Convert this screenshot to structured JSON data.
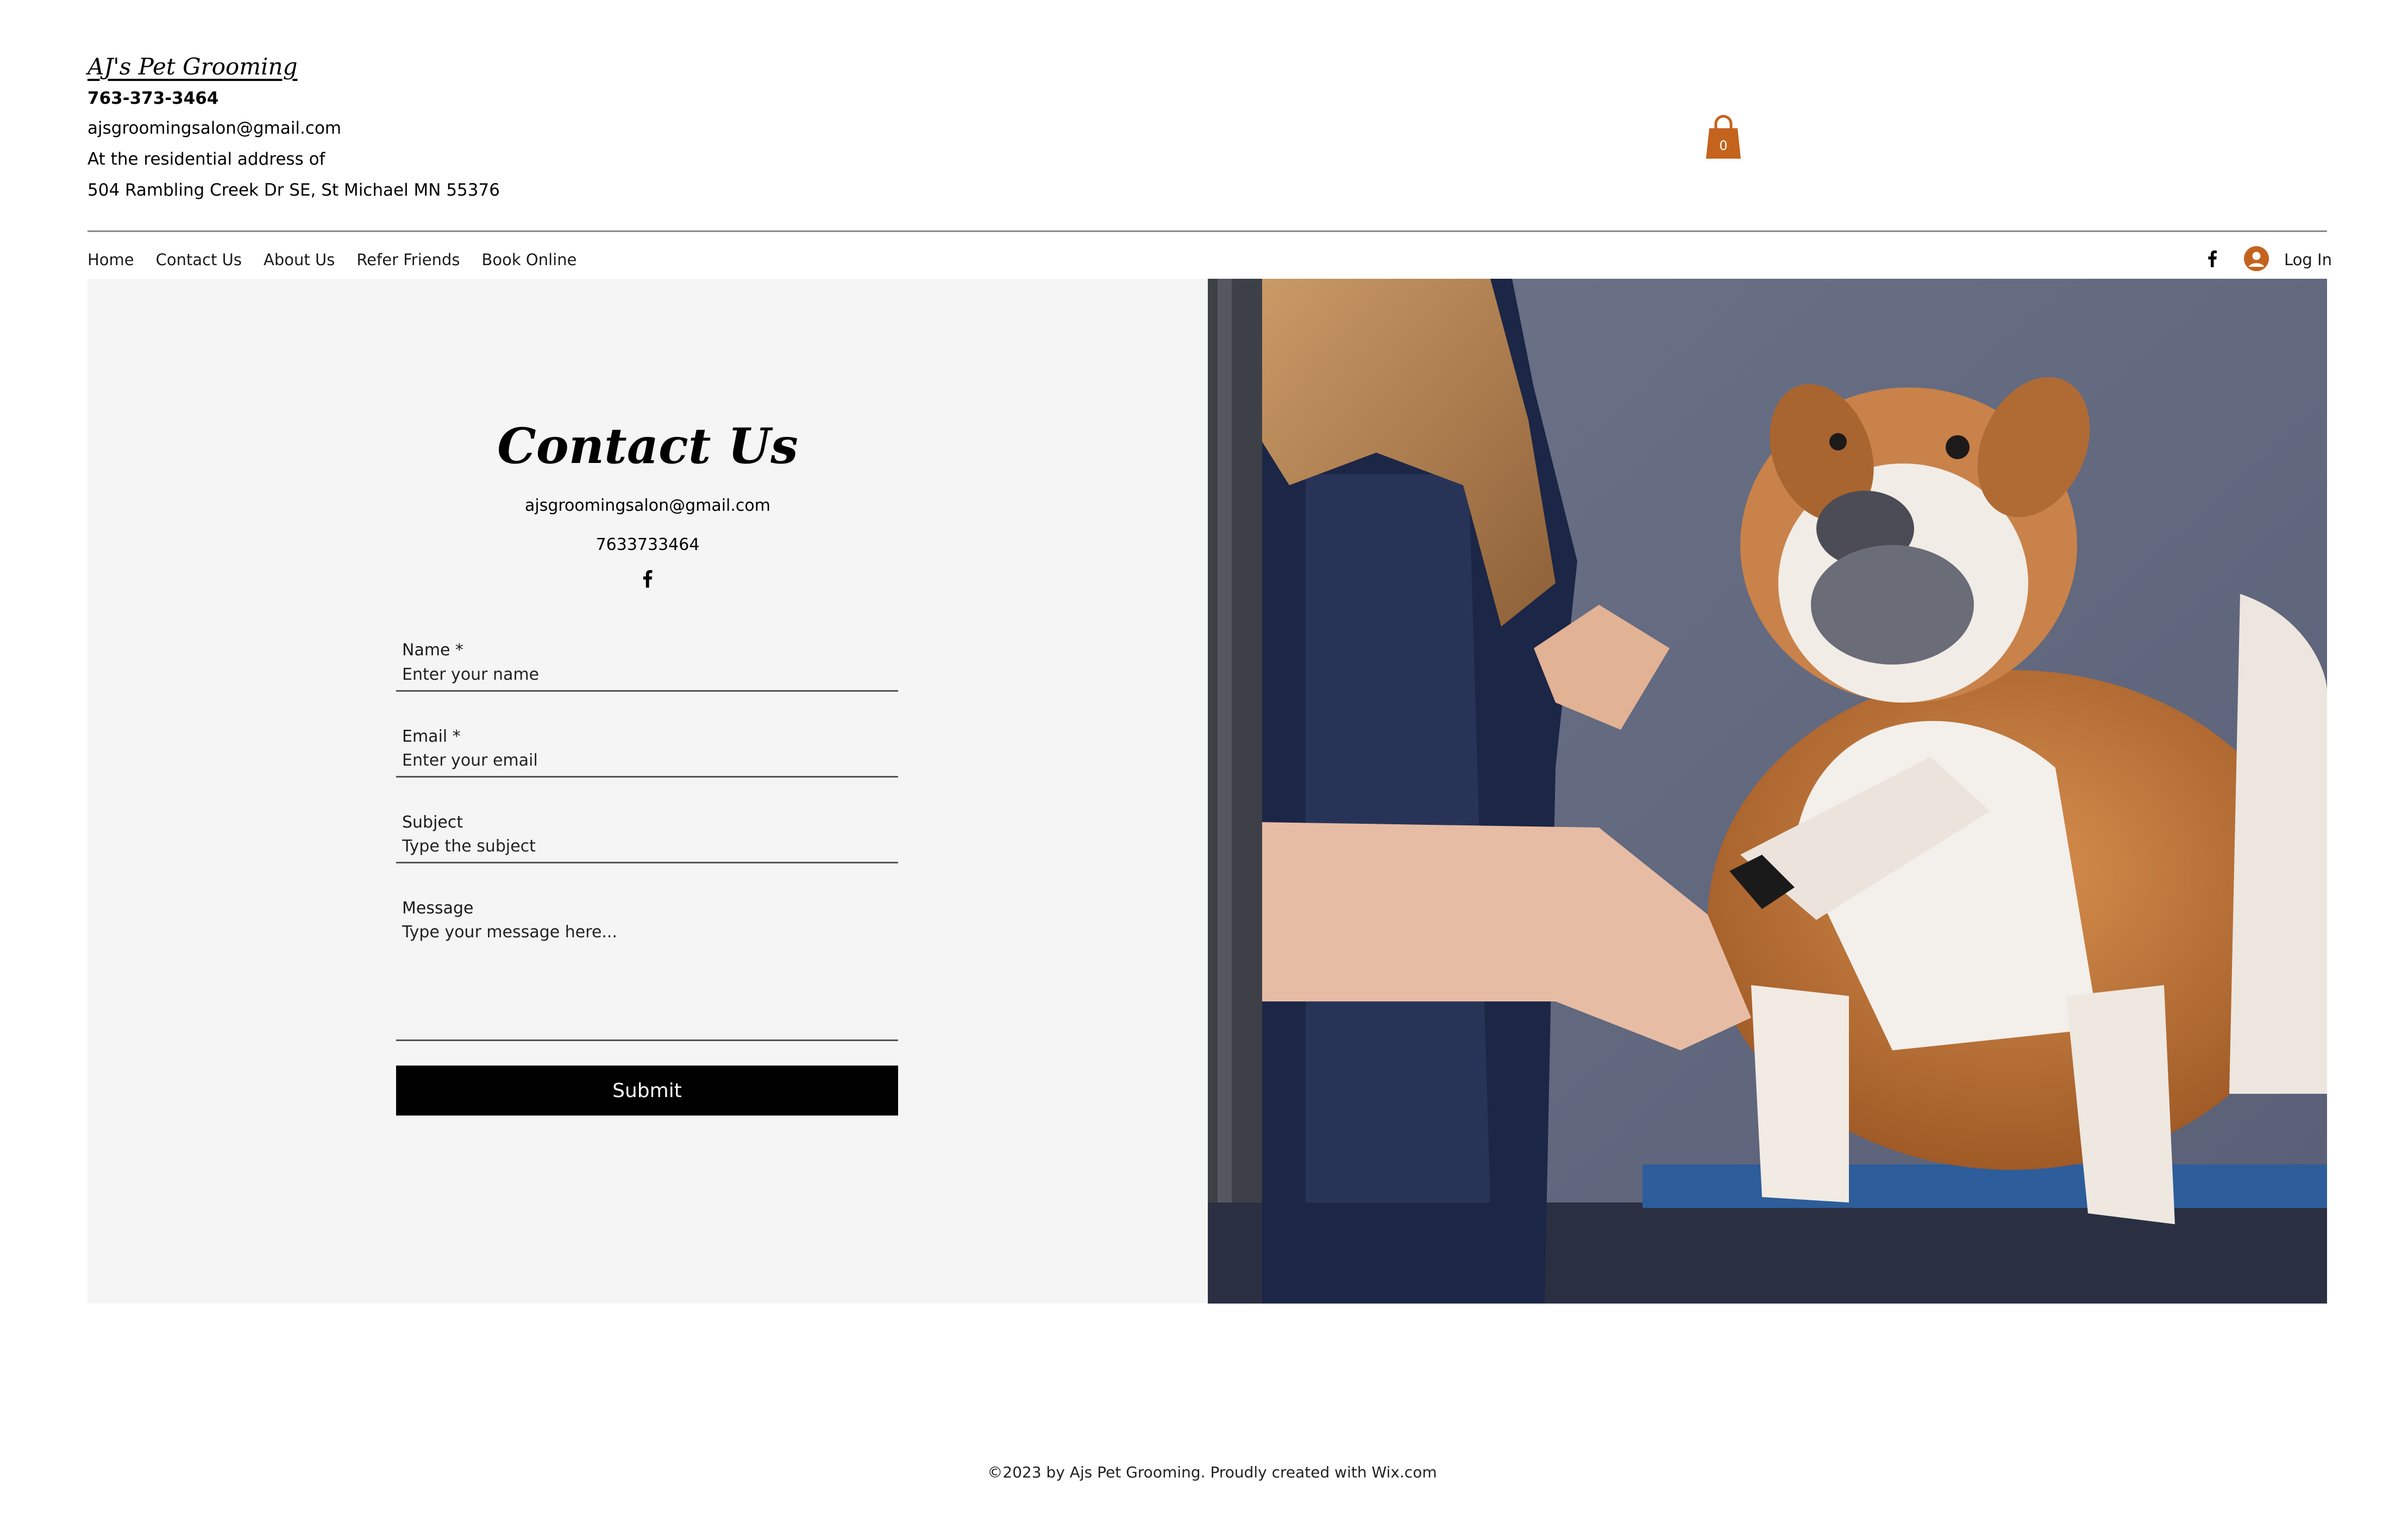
{
  "header": {
    "logo": "AJ's Pet Grooming",
    "phone": "763-373-3464",
    "email": "ajsgroomingsalon@gmail.com",
    "address_line1": "At the residential address of",
    "address_line2": "504 Rambling Creek Dr SE, St Michael MN 55376",
    "cart_count": "0",
    "cart_icon": "shopping-bag-icon",
    "cart_color": "#c4631d"
  },
  "nav": {
    "items": [
      "Home",
      "Contact Us",
      "About Us",
      "Refer Friends",
      "Book Online"
    ],
    "social_icon": "facebook-icon",
    "login_icon": "user-avatar-icon",
    "login_label": "Log In",
    "login_color": "#c4631d"
  },
  "contact": {
    "title": "Contact Us",
    "email": "ajsgroomingsalon@gmail.com",
    "phone": "7633733464",
    "social_icon": "facebook-icon"
  },
  "form": {
    "name_label": "Name *",
    "name_placeholder": "Enter your name",
    "email_label": "Email *",
    "email_placeholder": "Enter your email",
    "subject_label": "Subject",
    "subject_placeholder": "Type the subject",
    "message_label": "Message",
    "message_placeholder": "Type your message here...",
    "submit_label": "Submit"
  },
  "footer": {
    "text": "©2023 by Ajs Pet Grooming. Proudly created with Wix.com"
  }
}
